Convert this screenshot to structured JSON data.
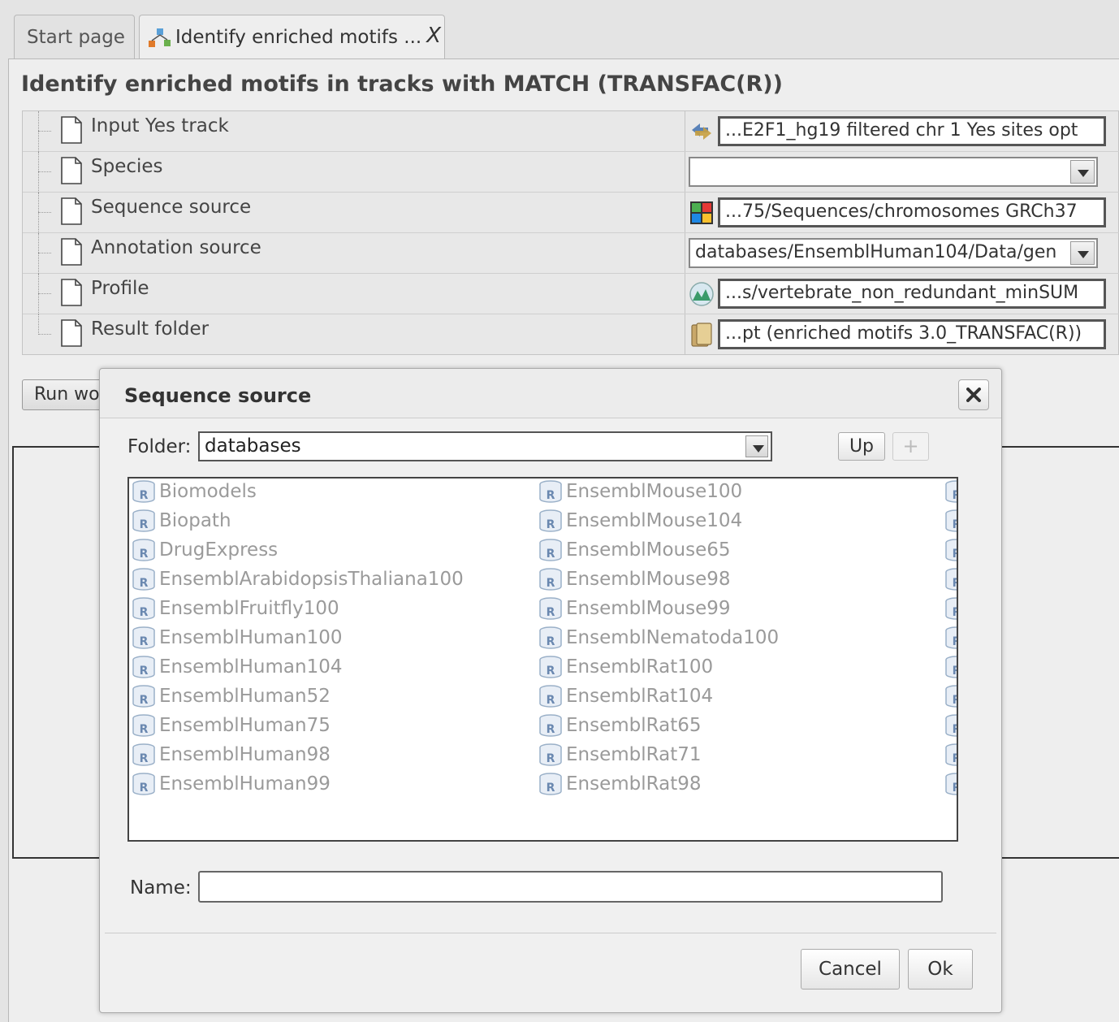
{
  "tabs": [
    {
      "label": "Start page"
    },
    {
      "label": "Identify enriched motifs ...",
      "close": "X"
    }
  ],
  "page_title": "Identify enriched motifs in tracks with MATCH (TRANSFAC(R))",
  "properties": [
    {
      "name": "Input Yes track",
      "value": "...E2F1_hg19 filtered chr 1 Yes sites opt",
      "icon": "track-icon"
    },
    {
      "name": "Species",
      "value": "",
      "icon": "dropdown"
    },
    {
      "name": "Sequence source",
      "value": "...75/Sequences/chromosomes GRCh37",
      "icon": "sequence-icon"
    },
    {
      "name": "Annotation source",
      "value": "databases/EnsemblHuman104/Data/gen",
      "icon": "dropdown"
    },
    {
      "name": "Profile",
      "value": "...s/vertebrate_non_redundant_minSUM",
      "icon": "profile-icon"
    },
    {
      "name": "Result folder",
      "value": "...pt (enriched motifs 3.0_TRANSFAC(R))",
      "icon": "folder-icon"
    }
  ],
  "run_button": "Run wo",
  "dialog": {
    "title": "Sequence source",
    "folder_label": "Folder:",
    "folder_value": "databases",
    "up_label": "Up",
    "plus_label": "+",
    "name_label": "Name:",
    "name_value": "",
    "cancel_label": "Cancel",
    "ok_label": "Ok",
    "items_col1": [
      "Biomodels",
      "Biopath",
      "DrugExpress",
      "EnsemblArabidopsisThaliana100",
      "EnsemblFruitfly100",
      "EnsemblHuman100",
      "EnsemblHuman104",
      "EnsemblHuman52",
      "EnsemblHuman75",
      "EnsemblHuman98",
      "EnsemblHuman99"
    ],
    "items_col2": [
      "EnsemblMouse100",
      "EnsemblMouse104",
      "EnsemblMouse65",
      "EnsemblMouse98",
      "EnsemblMouse99",
      "EnsemblNematoda100",
      "EnsemblRat100",
      "EnsemblRat104",
      "EnsemblRat65",
      "EnsemblRat71",
      "EnsemblRat98"
    ],
    "item_icon": "database-icon"
  }
}
